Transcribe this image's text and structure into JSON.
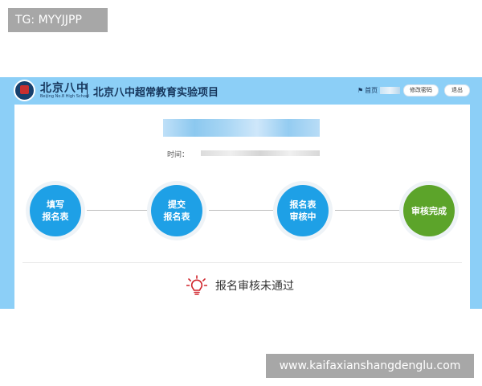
{
  "watermarks": {
    "top": "TG: MYYJJPP",
    "bottom": "www.kaifaxianshangdenglu.com"
  },
  "header": {
    "logo_cn": "北京八中",
    "logo_en": "Beijing No.8 High School",
    "project_title": "北京八中超常教育实验项目",
    "home_label": "首页",
    "change_password_label": "修改密码",
    "logout_label": "退出",
    "accent_color": "#8ccff7"
  },
  "main": {
    "time_label": "时间："
  },
  "steps": [
    {
      "label": "填写\n报名表",
      "color": "#1ea0e6"
    },
    {
      "label": "提交\n报名表",
      "color": "#1ea0e6"
    },
    {
      "label": "报名表\n审核中",
      "color": "#1ea0e6"
    },
    {
      "label": "审核完成",
      "color": "#5ca42a"
    }
  ],
  "status": {
    "icon": "lightbulb-icon",
    "text": "报名审核未通过",
    "icon_color": "#d0242b"
  }
}
